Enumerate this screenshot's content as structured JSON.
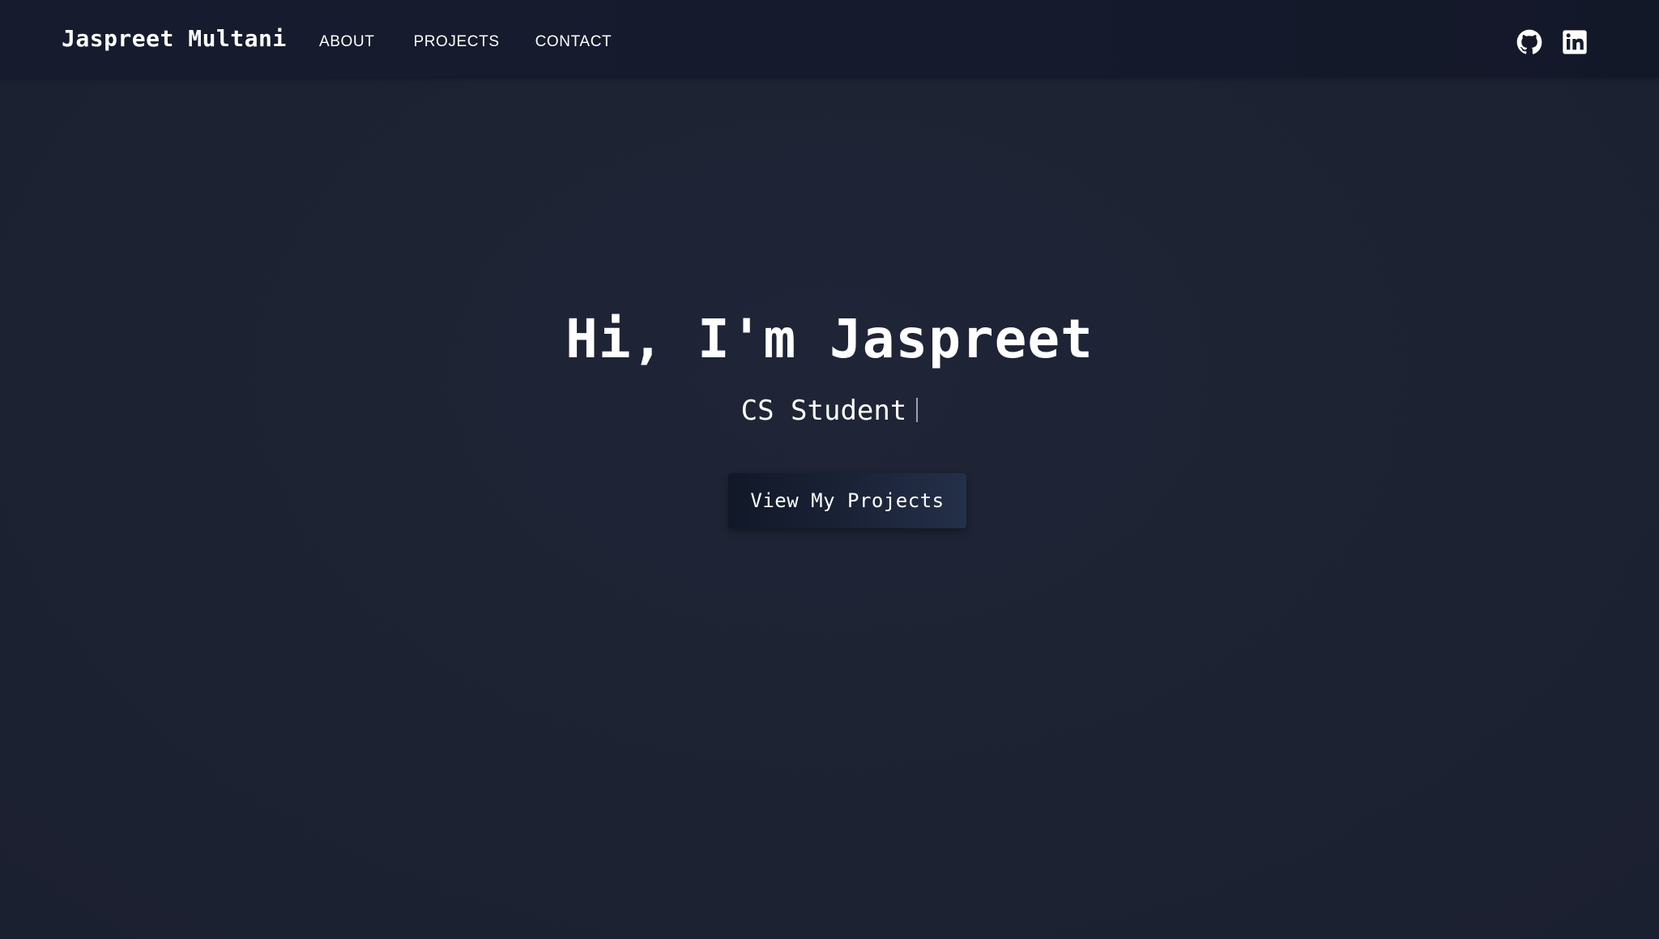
{
  "navbar": {
    "brand": "Jaspreet Multani",
    "links": [
      {
        "label": "ABOUT"
      },
      {
        "label": "PROJECTS"
      },
      {
        "label": "CONTACT"
      }
    ],
    "social": [
      {
        "icon": "github-icon"
      },
      {
        "icon": "linkedin-icon"
      }
    ]
  },
  "hero": {
    "title": "Hi, I'm Jaspreet",
    "subtitle": "CS Student",
    "cta_label": "View My Projects"
  },
  "colors": {
    "background": "#1e2434",
    "navbar": "#151a2c",
    "text": "#ffffff",
    "button_start": "#111828",
    "button_end": "#243049"
  }
}
